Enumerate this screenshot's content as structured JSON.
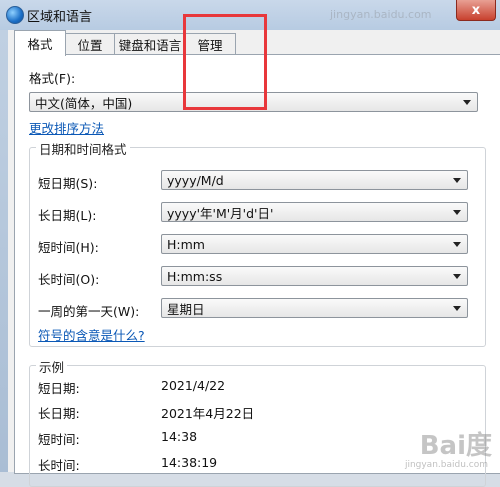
{
  "window": {
    "title": "区域和语言",
    "close_label": "x",
    "bg_url": "jingyan.baidu.com"
  },
  "tabs": [
    {
      "label": "格式"
    },
    {
      "label": "位置"
    },
    {
      "label": "键盘和语言"
    },
    {
      "label": "管理"
    }
  ],
  "format": {
    "label": "格式(F):",
    "value": "中文(简体，中国)",
    "change_sort_link": "更改排序方法"
  },
  "datetime": {
    "group_title": "日期和时间格式",
    "rows": [
      {
        "label": "短日期(S):",
        "value": "yyyy/M/d"
      },
      {
        "label": "长日期(L):",
        "value": "yyyy'年'M'月'd'日'"
      },
      {
        "label": "短时间(H):",
        "value": "H:mm"
      },
      {
        "label": "长时间(O):",
        "value": "H:mm:ss"
      },
      {
        "label": "一周的第一天(W):",
        "value": "星期日"
      }
    ],
    "symbol_link": "符号的含意是什么?"
  },
  "examples": {
    "group_title": "示例",
    "rows": [
      {
        "label": "短日期:",
        "value": "2021/4/22"
      },
      {
        "label": "长日期:",
        "value": "2021年4月22日"
      },
      {
        "label": "短时间:",
        "value": "14:38"
      },
      {
        "label": "长时间:",
        "value": "14:38:19"
      }
    ]
  },
  "watermark": {
    "brand": "Bai度",
    "sub": "jingyan.baidu.com"
  },
  "colors": {
    "highlight": "#e8373b",
    "link": "#0b58b6"
  }
}
